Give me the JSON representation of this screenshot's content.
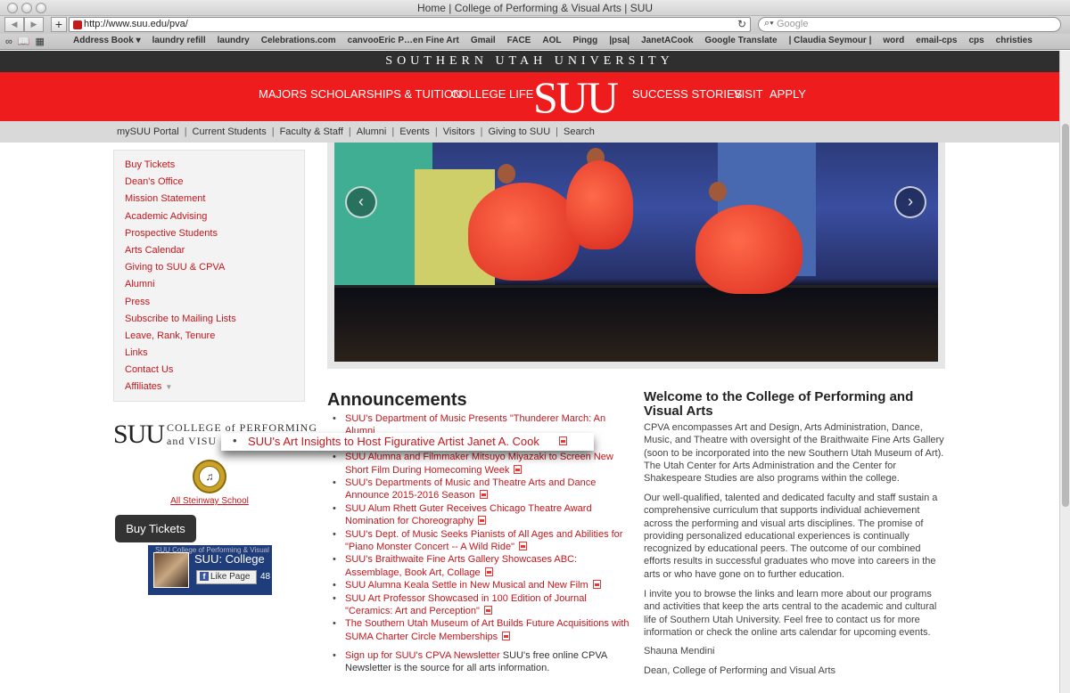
{
  "browser": {
    "window_title": "Home | College of Performing & Visual Arts | SUU",
    "url": "http://www.suu.edu/pva/",
    "search_placeholder": "Google",
    "bookmarks": [
      "Address Book ▾",
      "laundry refill",
      "laundry",
      "Celebrations.com",
      "canvooEric P…en Fine Art",
      "Gmail",
      "FACE",
      "AOL",
      "Pingg",
      "|psa|",
      "JanetACook",
      "Google Translate",
      "| Claudia Seymour |",
      "word",
      "email-cps",
      "cps",
      "christies"
    ]
  },
  "header": {
    "university": "SOUTHERN UTAH UNIVERSITY",
    "logo": "SUU",
    "nav": [
      "MAJORS",
      "SCHOLARSHIPS & TUITION",
      "COLLEGE LIFE",
      "SUCCESS STORIES",
      "VISIT",
      "APPLY"
    ],
    "utility": [
      "mySUU Portal",
      "Current Students",
      "Faculty & Staff",
      "Alumni",
      "Events",
      "Visitors",
      "Giving to SUU",
      "Search"
    ]
  },
  "sidebar": {
    "items": [
      "Buy Tickets",
      "Dean's Office",
      "Mission Statement",
      "Academic Advising",
      "Prospective Students",
      "Arts Calendar",
      "Giving to SUU & CPVA",
      "Alumni",
      "Press",
      "Subscribe to Mailing Lists",
      "Leave, Rank, Tenure",
      "Links",
      "Contact Us",
      "Affiliates"
    ],
    "cpva_logo_suu": "SUU",
    "cpva_logo_line1": "COLLEGE of PERFORMING",
    "cpva_logo_line2": "and VISU",
    "steinway_link": "All Steinway School",
    "buy_tickets_button": "Buy Tickets",
    "facebook": {
      "subtitle": "SUU College of Performing & Visual",
      "title": "SUU: College",
      "like_button": "Like Page",
      "count": "48"
    }
  },
  "announcements": {
    "heading": "Announcements",
    "items": [
      {
        "text": "SUU's Department of Music Presents \"Thunderer March: An Alumni",
        "pdf": false
      },
      {
        "text": "",
        "pdf": false
      },
      {
        "text": "SUU Alumna and Filmmaker Mitsuyo Miyazaki to Screen New Short Film During Homecoming Week",
        "pdf": true
      },
      {
        "text": "SUU's Departments of Music and Theatre Arts and Dance Announce 2015-2016 Season",
        "pdf": true
      },
      {
        "text": "SUU Alum Rhett Guter Receives Chicago Theatre Award Nomination for Choreography",
        "pdf": true
      },
      {
        "text": "SUU's Dept. of Music Seeks Pianists of All Ages and Abilities for \"Piano Monster Concert -- A Wild Ride\"",
        "pdf": true
      },
      {
        "text": "SUU's Braithwaite Fine Arts Gallery Showcases ABC: Assemblage, Book Art, Collage",
        "pdf": true
      },
      {
        "text": "SUU Alumna Keala Settle in New Musical and New Film",
        "pdf": true
      },
      {
        "text": "SUU Art Professor Showcased in 100 Edition of Journal \"Ceramics: Art and Perception\"",
        "pdf": true
      },
      {
        "text": "The Southern Utah Museum of Art Builds Future Acquisitions with SUMA Charter Circle Memberships",
        "pdf": true
      }
    ],
    "ticker": "SUU's Art Insights to Host Figurative Artist Janet A. Cook",
    "newsletter_link": "Sign up for SUU's CPVA Newsletter",
    "newsletter_text": " SUU's free online CPVA Newsletter is the source for all arts information."
  },
  "welcome": {
    "title": "Welcome to the College of Performing and Visual Arts",
    "p1": "CPVA encompasses Art and Design, Arts Administration, Dance, Music, and Theatre with oversight of the Braithwaite Fine Arts Gallery (soon to be incorporated into the new Southern Utah Museum of Art). The Utah Center for Arts Administration and the Center for Shakespeare Studies are also programs within the college.",
    "p2": "Our well-qualified, talented and dedicated faculty and staff sustain a comprehensive curriculum that supports individual achievement across the performing and visual arts disciplines. The promise of providing personalized educational experiences is continually recognized by educational peers. The outcome of our combined efforts results in successful graduates who move into careers in the arts or who have gone on to further education.",
    "p3": "I invite you to browse the links and learn more about our programs and activities that keep the arts central to the academic and cultural life of Southern Utah University. Feel free to contact us for more information or check the online arts calendar for upcoming events.",
    "signature": "Shauna Mendini",
    "sig_title": "Dean, College of Performing and Visual Arts"
  },
  "colors": {
    "brand_red": "#ee1c1c",
    "link_red": "#c4161c",
    "dark_bar": "#2f2f2f"
  }
}
